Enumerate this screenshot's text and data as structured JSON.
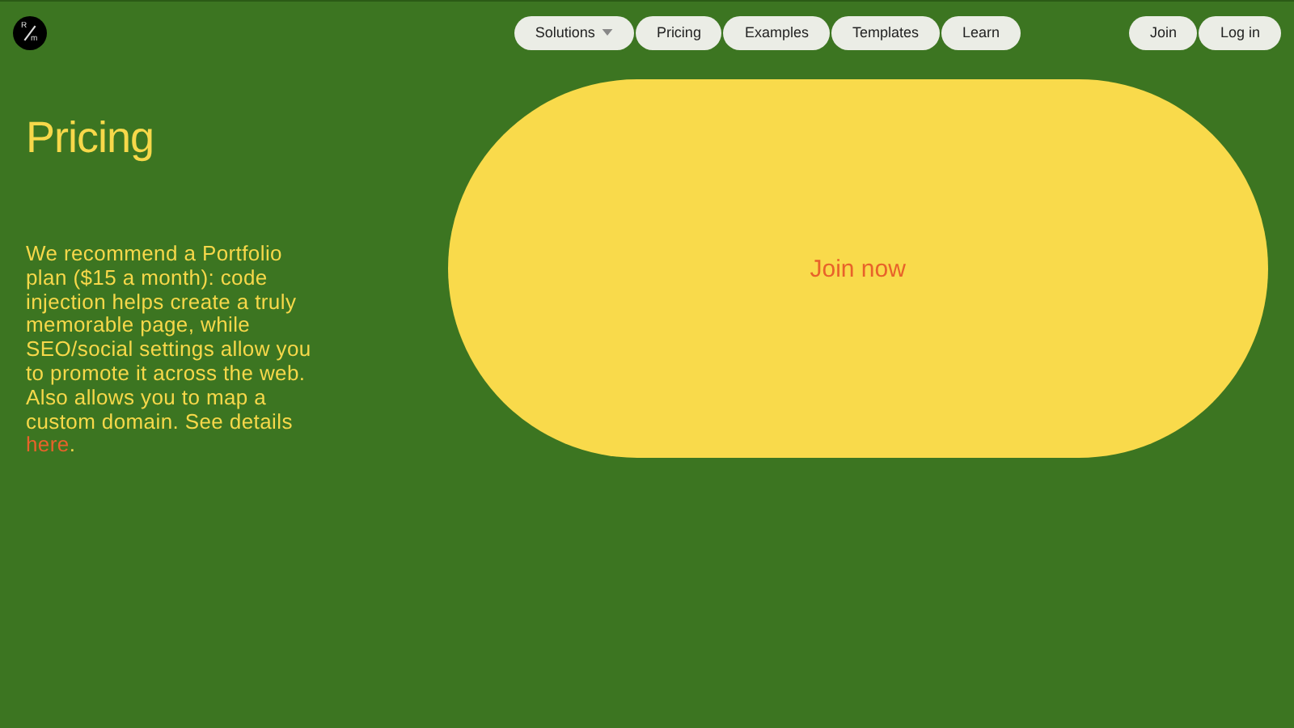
{
  "logo": {
    "top": "R",
    "bottom": "m"
  },
  "nav": [
    {
      "label": "Solutions",
      "dropdown": true
    },
    {
      "label": "Pricing",
      "dropdown": false
    },
    {
      "label": "Examples",
      "dropdown": false
    },
    {
      "label": "Templates",
      "dropdown": false
    },
    {
      "label": "Learn",
      "dropdown": false
    }
  ],
  "account": [
    "Join",
    "Log in"
  ],
  "heading": "Pricing",
  "description": {
    "text": "We recommend a Portfolio plan ($15 a month): code injection helps create a truly memorable page, while SEO/social settings allow you to promote it across the web. Also allows you to map a custom domain. See details",
    "link": "here",
    "end": "."
  },
  "cta": "Join now"
}
